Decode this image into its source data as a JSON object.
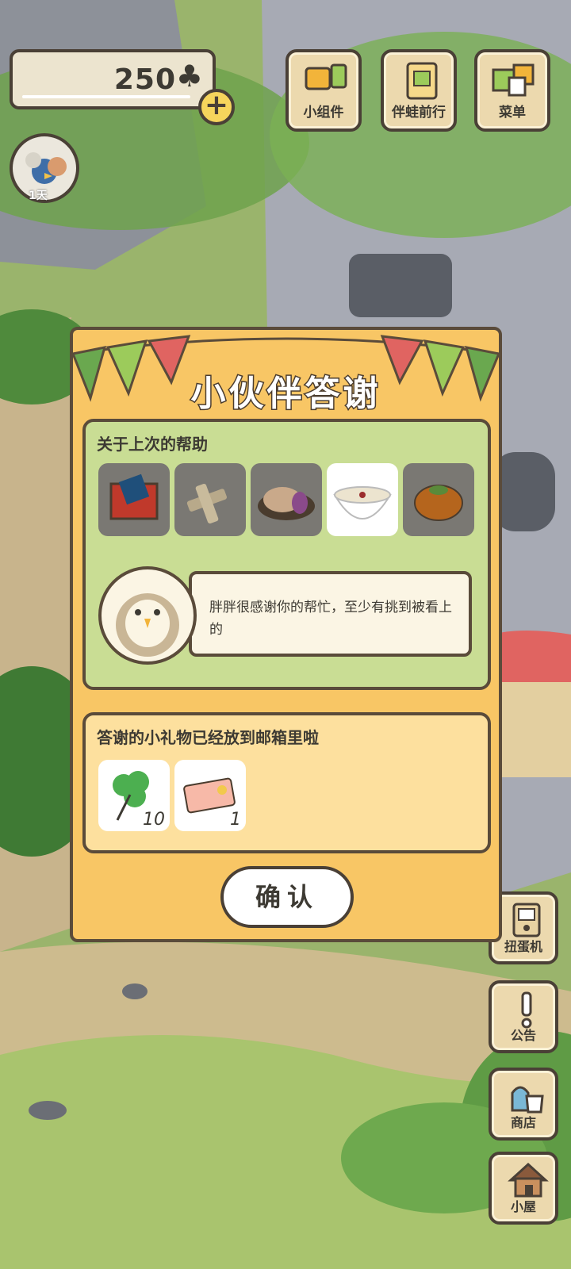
{
  "hud": {
    "clover_count": "250",
    "clover_symbol": "♣",
    "plus_label": "+",
    "visitor_days": "1天"
  },
  "top_menu": [
    {
      "label": "小组件",
      "icon": "widget-icon"
    },
    {
      "label": "伴蛙前行",
      "icon": "journal-icon"
    },
    {
      "label": "菜单",
      "icon": "menu-cards-icon"
    }
  ],
  "side_menu": [
    {
      "label": "扭蛋机",
      "icon": "gacha-icon"
    },
    {
      "label": "公告",
      "icon": "notice-icon"
    },
    {
      "label": "商店",
      "icon": "shop-icon"
    },
    {
      "label": "小屋",
      "icon": "house-icon"
    }
  ],
  "dialog": {
    "title": "小伙伴答谢",
    "help_section_title": "关于上次的帮助",
    "items": [
      {
        "icon": "gift-box-icon",
        "selected": false
      },
      {
        "icon": "biscuit-sticks-icon",
        "selected": false
      },
      {
        "icon": "mooncake-icon",
        "selected": false
      },
      {
        "icon": "porridge-bowl-icon",
        "selected": true
      },
      {
        "icon": "persimmon-icon",
        "selected": false
      }
    ],
    "message": "胖胖很感谢你的帮忙，至少有挑到被看上的",
    "gift_section_title": "答谢的小礼物已经放到邮箱里啦",
    "rewards": [
      {
        "icon": "clover-icon",
        "qty": "10"
      },
      {
        "icon": "ticket-icon",
        "qty": "1"
      }
    ],
    "confirm_label": "确认"
  },
  "colors": {
    "dialog_bg": "#f8c665",
    "panel_green": "#c9dd94",
    "panel_yellow": "#fde09e",
    "outline": "#5a4b3a"
  }
}
